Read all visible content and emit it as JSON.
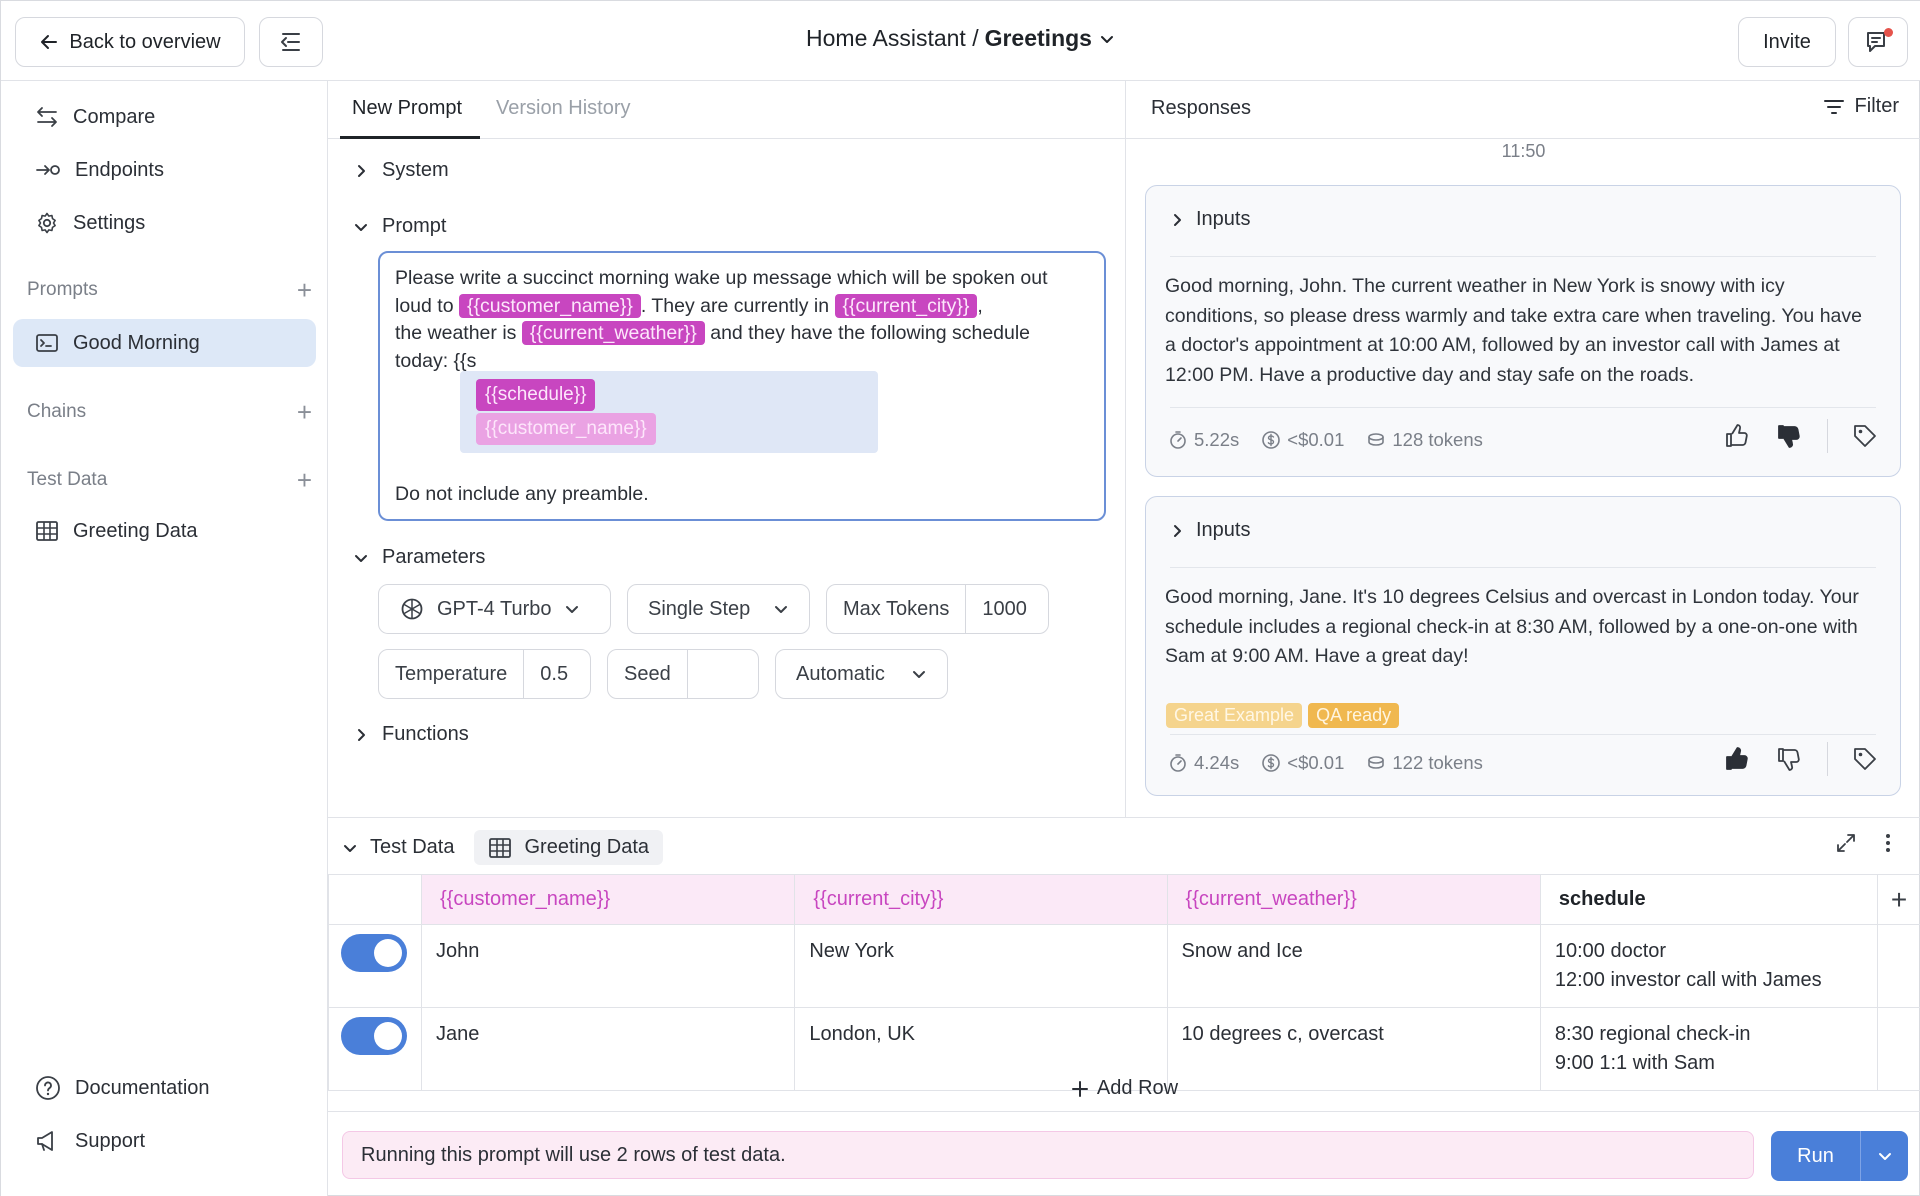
{
  "header": {
    "back_label": "Back to overview",
    "breadcrumb_parent": "Home Assistant /",
    "breadcrumb_current": "Greetings",
    "invite_label": "Invite"
  },
  "sidebar": {
    "nav": [
      {
        "label": "Compare",
        "icon": "compare-arrows-icon"
      },
      {
        "label": "Endpoints",
        "icon": "endpoint-icon"
      },
      {
        "label": "Settings",
        "icon": "gear-icon"
      }
    ],
    "prompts_label": "Prompts",
    "prompts": [
      {
        "label": "Good Morning",
        "icon": "terminal-icon"
      }
    ],
    "chains_label": "Chains",
    "test_data_label": "Test Data",
    "test_data_items": [
      {
        "label": "Greeting Data",
        "icon": "table-icon"
      }
    ],
    "footer": [
      {
        "label": "Documentation",
        "icon": "question-circle-icon"
      },
      {
        "label": "Support",
        "icon": "megaphone-icon"
      }
    ]
  },
  "editor": {
    "tabs": [
      "New Prompt",
      "Version History"
    ],
    "system_label": "System",
    "prompt_label": "Prompt",
    "prompt_text": {
      "p1": "Please write a succinct morning wake up message which will be spoken out loud to",
      "v1": "{{customer_name}}",
      "p2": ".  They are currently in",
      "v2": "{{current_city}}",
      "p3": ",",
      "p4": "the weather is",
      "v3": "{{current_weather}}",
      "p5": "and they have the following schedule",
      "p6": "today: {{s",
      "preamble": "Do not include any preamble."
    },
    "autocomplete": [
      "{{schedule}}",
      "{{customer_name}}"
    ],
    "parameters_label": "Parameters",
    "params": {
      "model": "GPT-4 Turbo",
      "mode": "Single Step",
      "max_tokens_label": "Max Tokens",
      "max_tokens_value": "1000",
      "temperature_label": "Temperature",
      "temperature_value": "0.5",
      "seed_label": "Seed",
      "seed_value": "",
      "response_format": "Automatic"
    },
    "functions_label": "Functions"
  },
  "responses": {
    "title": "Responses",
    "filter_label": "Filter",
    "time": "11:50",
    "cards": [
      {
        "inputs_label": "Inputs",
        "text": "Good morning, John. The current weather in New York is snowy with icy conditions, so please dress warmly and take extra care when traveling. You have a doctor's appointment at 10:00 AM, followed by an investor call with James at 12:00 PM. Have a productive day and stay safe on the roads.",
        "duration": "5.22s",
        "cost": "<$0.01",
        "tokens": "128 tokens",
        "tags": []
      },
      {
        "inputs_label": "Inputs",
        "text": "Good morning, Jane. It's 10 degrees Celsius and overcast in London today. Your schedule includes a regional check-in at 8:30 AM, followed by a one-on-one with Sam at 9:00 AM. Have a great day!",
        "duration": "4.24s",
        "cost": "<$0.01",
        "tokens": "122 tokens",
        "tags": [
          "Great Example",
          "QA ready"
        ]
      }
    ]
  },
  "test_data": {
    "label": "Test Data",
    "dataset": "Greeting Data",
    "columns": [
      "{{customer_name}}",
      "{{current_city}}",
      "{{current_weather}}",
      "schedule"
    ],
    "rows": [
      {
        "enabled": true,
        "cells": [
          "John",
          "New York",
          "Snow and Ice",
          "10:00 doctor\n12:00 investor call with James"
        ]
      },
      {
        "enabled": true,
        "cells": [
          "Jane",
          "London, UK",
          "10 degrees c, overcast",
          "8:30 regional check-in\n9:00 1:1 with Sam"
        ]
      }
    ],
    "add_row_label": "Add Row",
    "notice": "Running this prompt will use 2 rows of test data.",
    "run_label": "Run"
  },
  "colors": {
    "accent": "#4a7fd9",
    "variable": "#c846c0",
    "active_nav": "#dde8f7"
  }
}
